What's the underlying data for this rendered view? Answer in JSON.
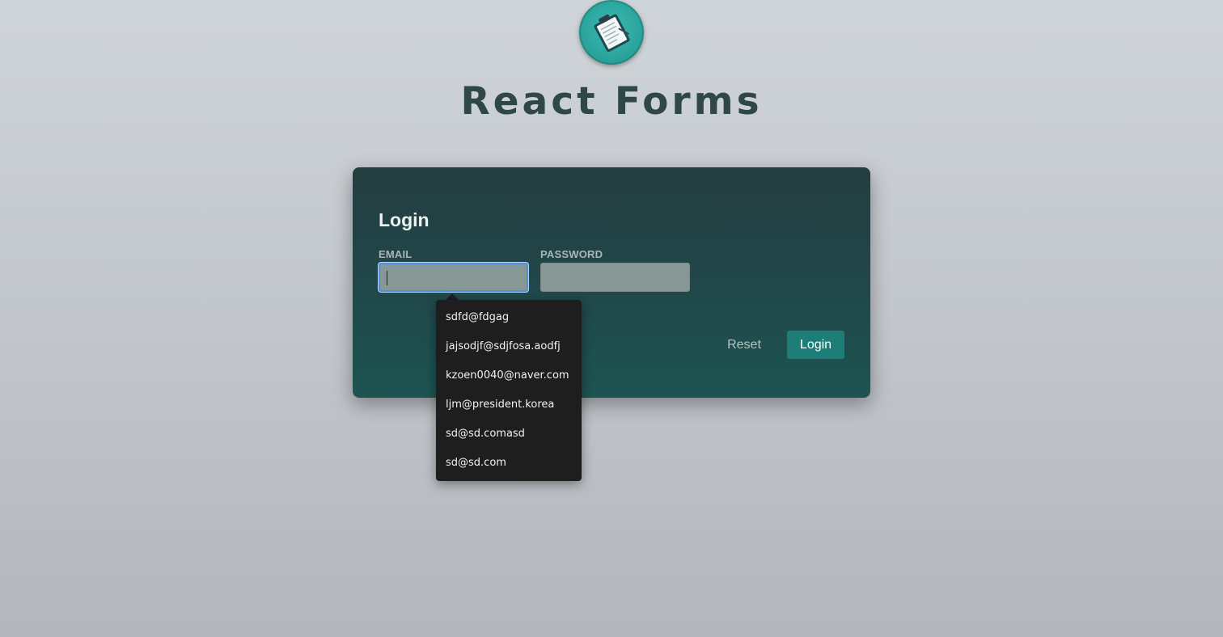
{
  "app": {
    "title": "React Forms",
    "logo_icon": "clipboard-icon"
  },
  "login_form": {
    "heading": "Login",
    "email_label": "EMAIL",
    "email_value": "",
    "password_label": "PASSWORD",
    "password_value": "",
    "reset_label": "Reset",
    "submit_label": "Login"
  },
  "autocomplete": {
    "suggestions": [
      "sdfd@fdgag",
      "jajsodjf@sdjfosa.aodfj",
      "kzoen0040@naver.com",
      "ljm@president.korea",
      "sd@sd.comasd",
      "sd@sd.com"
    ]
  },
  "colors": {
    "card_top": "#243d40",
    "card_bottom": "#1d5452",
    "accent": "#1c7e76",
    "title_text": "#2f4746",
    "focus_ring": "#4f8fe0"
  }
}
